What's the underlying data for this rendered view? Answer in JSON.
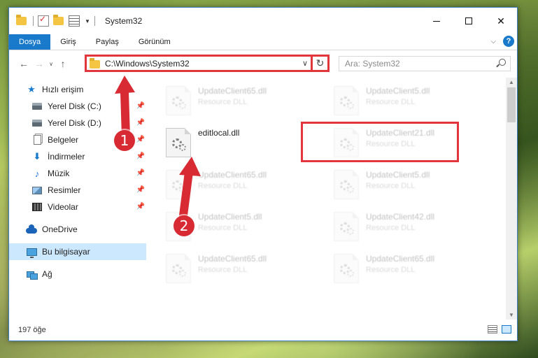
{
  "window": {
    "title": "System32",
    "controls": {
      "minimize": "min",
      "maximize": "max",
      "close": "✕"
    }
  },
  "ribbon": {
    "tabs": [
      "Dosya",
      "Giriş",
      "Paylaş",
      "Görünüm"
    ],
    "help": "?"
  },
  "address": {
    "path": "C:\\Windows\\System32",
    "search_placeholder": "Ara: System32"
  },
  "nav_pane": {
    "quick_access": "Hızlı erişim",
    "items": [
      {
        "label": "Yerel Disk (C:)",
        "icon": "drive-icon"
      },
      {
        "label": "Yerel Disk (D:)",
        "icon": "drive-icon"
      },
      {
        "label": "Belgeler",
        "icon": "documents-icon"
      },
      {
        "label": "İndirmeler",
        "icon": "download-icon"
      },
      {
        "label": "Müzik",
        "icon": "music-icon"
      },
      {
        "label": "Resimler",
        "icon": "pictures-icon"
      },
      {
        "label": "Videolar",
        "icon": "videos-icon"
      }
    ],
    "onedrive": "OneDrive",
    "this_pc": "Bu bilgisayar",
    "network": "Ağ"
  },
  "files": [
    {
      "name": "UpdateClient65.dll",
      "type": "Resource DLL"
    },
    {
      "name": "UpdateClient5.dll",
      "type": "Resource DLL"
    },
    {
      "name": "editlocal.dll",
      "type": ""
    },
    {
      "name": "UpdateClient21.dll",
      "type": "Resource DLL"
    },
    {
      "name": "UpdateClient65.dll",
      "type": "Resource DLL"
    },
    {
      "name": "UpdateClient5.dll",
      "type": "Resource DLL"
    },
    {
      "name": "UpdateClient5.dll",
      "type": "Resource DLL"
    },
    {
      "name": "UpdateClient42.dll",
      "type": "Resource DLL"
    },
    {
      "name": "UpdateClient65.dll",
      "type": "Resource DLL"
    },
    {
      "name": "UpdateClient65.dll",
      "type": "Resource DLL"
    }
  ],
  "status": {
    "count": "197 öğe"
  },
  "callouts": {
    "one": "1",
    "two": "2"
  },
  "colors": {
    "accent": "#1979ca",
    "callout": "#d82a32",
    "highlight": "#e2353c"
  }
}
